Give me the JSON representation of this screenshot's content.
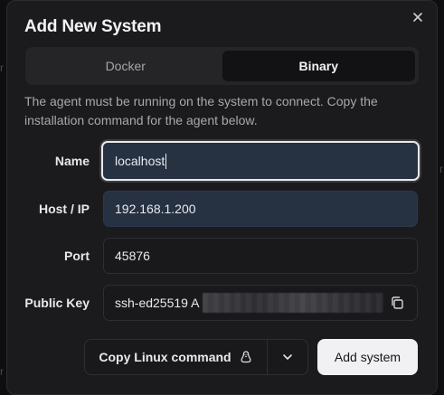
{
  "dialog": {
    "title": "Add New System",
    "close_icon": "close-icon"
  },
  "tabs": [
    {
      "label": "Docker",
      "active": false
    },
    {
      "label": "Binary",
      "active": true
    }
  ],
  "description": "The agent must be running on the system to connect. Copy the installation command for the agent below.",
  "form": {
    "name": {
      "label": "Name",
      "value": "localhost"
    },
    "host": {
      "label": "Host / IP",
      "value": "192.168.1.200"
    },
    "port": {
      "label": "Port",
      "value": "45876"
    },
    "public_key": {
      "label": "Public Key",
      "value": "ssh-ed25519 A",
      "copy_icon": "copy-icon"
    }
  },
  "actions": {
    "copy_command_label": "Copy Linux command",
    "copy_command_icon": "linux-tux-icon",
    "more_icon": "chevron-down-icon",
    "add_label": "Add system"
  },
  "colors": {
    "dialog_bg": "#1b1b1e",
    "field_filled": "#263142",
    "primary_button": "#f1f1f3"
  }
}
